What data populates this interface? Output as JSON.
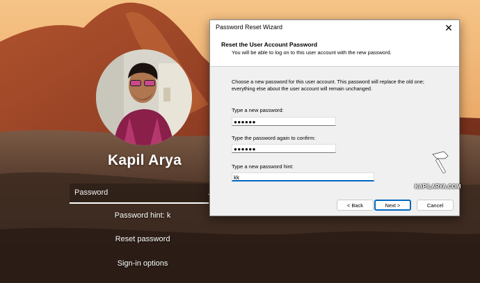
{
  "lockscreen": {
    "user_name": "Kapil Arya",
    "password_placeholder": "Password",
    "submit_icon": "arrow-right-icon",
    "password_hint": "Password hint: k",
    "reset_password_link": "Reset password",
    "signin_options_link": "Sign-in options"
  },
  "wizard": {
    "window_title": "Password Reset Wizard",
    "header_title": "Reset the User Account Password",
    "header_subtitle": "You will be able to log on to this user account with the new password.",
    "description": "Choose a new password for this user account. This password will replace the old one; everything else about the user account will remain unchanged.",
    "new_password_label": "Type a new password:",
    "new_password_value": "●●●●●●",
    "confirm_label": "Type the password again to confirm:",
    "confirm_value": "●●●●●●",
    "hint_label": "Type a new password hint:",
    "hint_value": "kk",
    "back_button": "< Back",
    "next_button": "Next >",
    "cancel_button": "Cancel",
    "close_icon": "close-icon"
  },
  "watermark": {
    "text": "KAPILARYA.COM",
    "icon": "hammer-icon"
  },
  "colors": {
    "accent": "#0067c0",
    "dialog_bg": "#f0f0f0",
    "sky": "#f2a55a",
    "rock": "#8a3a22"
  }
}
